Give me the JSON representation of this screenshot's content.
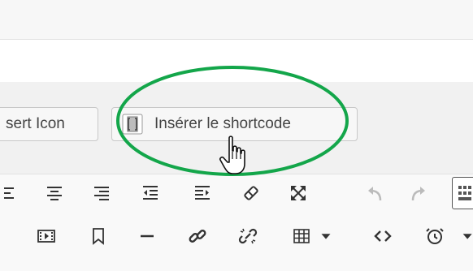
{
  "buttons": {
    "insert_icon_label": "sert Icon",
    "insert_shortcode_label": "Insérer le shortcode"
  },
  "toolbar": {
    "row1": [
      "align-left-icon",
      "align-center-icon",
      "align-right-icon",
      "outdent-icon",
      "indent-icon",
      "clear-formatting-icon",
      "fullscreen-icon",
      "undo-icon",
      "redo-icon",
      "toolbar-toggle-icon"
    ],
    "row2": [
      "media-icon",
      "bookmark-icon",
      "horizontal-line-icon",
      "link-icon",
      "unlink-icon",
      "table-icon",
      "code-icon",
      "clock-icon"
    ]
  },
  "annotation": {
    "highlight_color": "#13a64a"
  }
}
